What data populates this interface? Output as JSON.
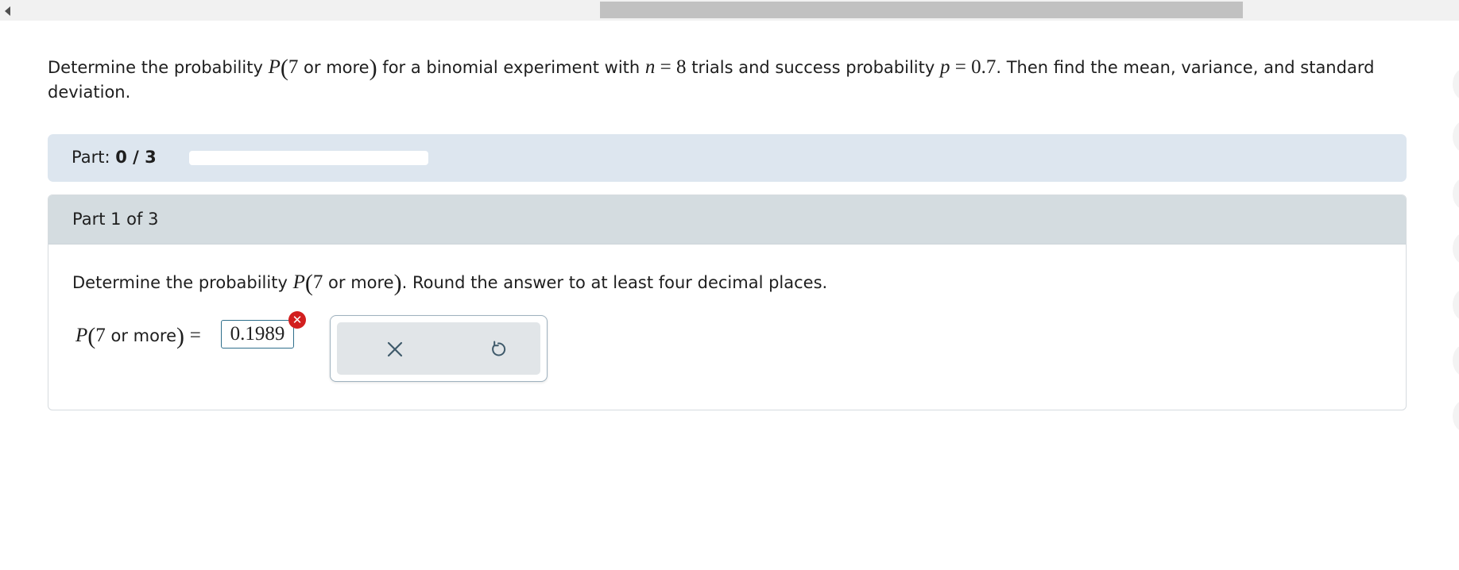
{
  "problem": {
    "text_before": "Determine the probability",
    "P": "P",
    "arg_num": "7",
    "arg_text": "or more",
    "text_mid1": "for a binomial experiment with",
    "n_var": "n",
    "eq": "=",
    "n_val": "8",
    "text_mid2": "trials and success probability",
    "p_var": "p",
    "p_val": "0.7",
    "text_after": ". Then find the mean, variance, and standard deviation."
  },
  "part_bar": {
    "label": "Part:",
    "progress_text": "0 / 3",
    "progress_fraction": 0
  },
  "part_card": {
    "heading": "Part 1 of 3"
  },
  "question": {
    "text_before": "Determine the probability",
    "P": "P",
    "arg_num": "7",
    "arg_text": "or more",
    "text_after": ". Round the answer to at least four decimal places."
  },
  "answer": {
    "P": "P",
    "arg_num": "7",
    "arg_text": "or more",
    "eq": "=",
    "value": "0.1989",
    "status": "incorrect"
  },
  "tools": {
    "clear_icon": "close-icon",
    "undo_icon": "undo-icon"
  },
  "colors": {
    "part_bar_bg": "#dde6ef",
    "card_header_bg": "#d4dce0",
    "error_red": "#d21f1f",
    "input_border": "#2f6f8c"
  }
}
